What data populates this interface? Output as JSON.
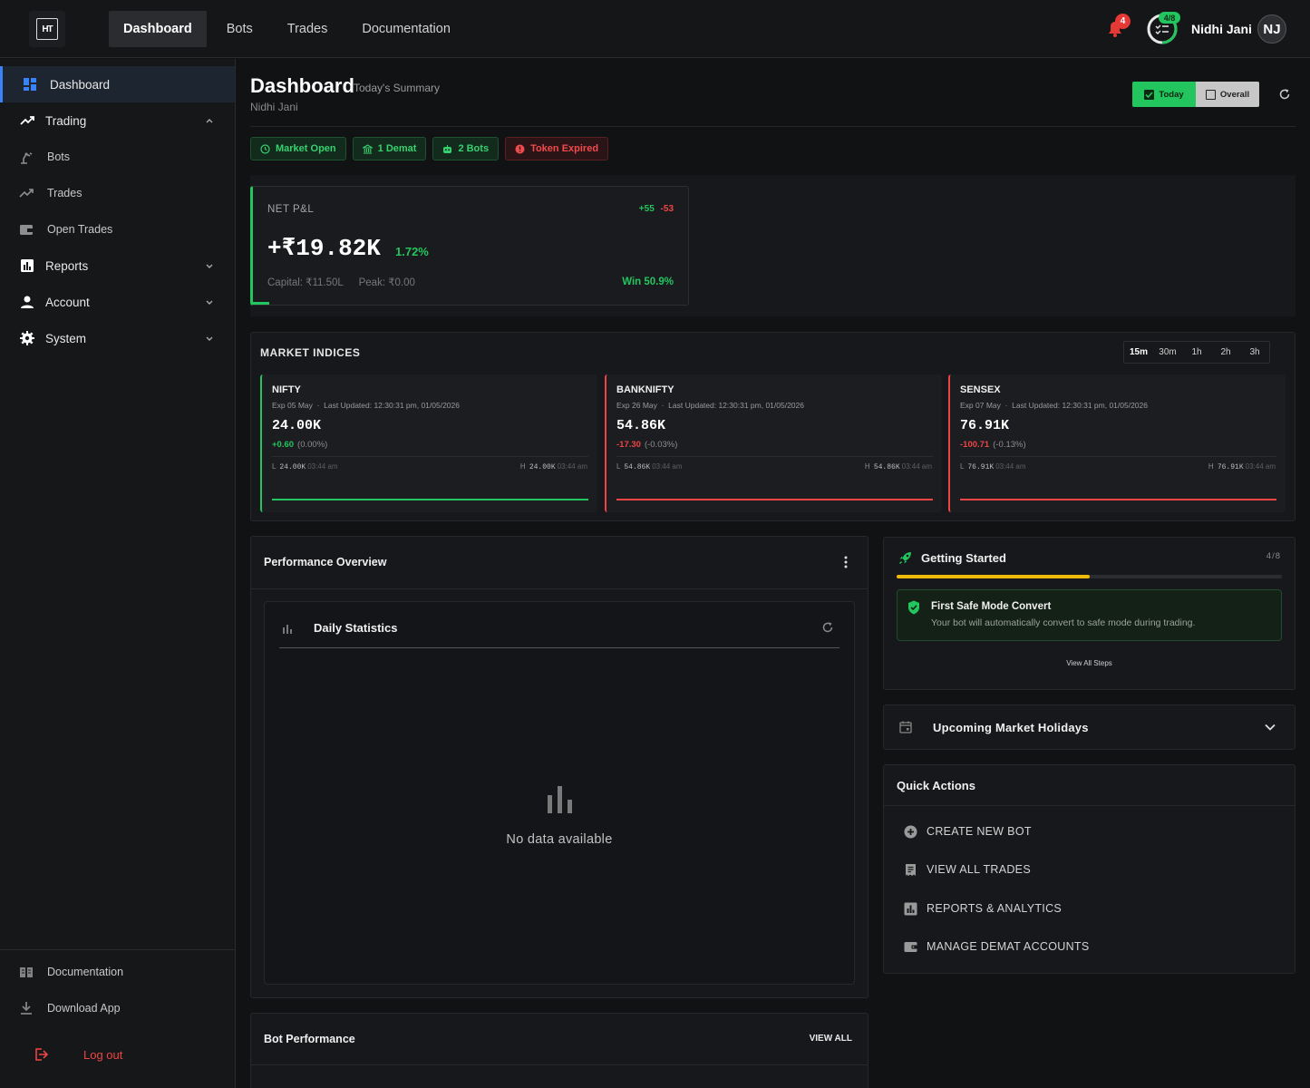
{
  "topbar": {
    "logo_text": "HT",
    "nav": [
      "Dashboard",
      "Bots",
      "Trades",
      "Documentation"
    ],
    "active_nav": "Dashboard",
    "notification_count": "4",
    "progress_badge": "4/8",
    "progress_fraction": 0.5,
    "user_name": "Nidhi Jani",
    "avatar_initials": "NJ"
  },
  "sidebar": {
    "dashboard": "Dashboard",
    "trading": "Trading",
    "trading_items": [
      "Bots",
      "Trades",
      "Open Trades"
    ],
    "reports": "Reports",
    "account": "Account",
    "system": "System",
    "documentation": "Documentation",
    "download": "Download App",
    "logout": "Log out"
  },
  "header": {
    "title": "Dashboard",
    "subtitle": "Today's Summary",
    "user": "Nidhi Jani",
    "toggle_today": "Today",
    "toggle_overall": "Overall"
  },
  "chips": {
    "market": "Market Open",
    "demat": "1 Demat",
    "bots": "2 Bots",
    "token": "Token Expired"
  },
  "pnl": {
    "label": "NET P&L",
    "wins": "+55",
    "losses": "-53",
    "value": "+₹19.82K",
    "percent": "1.72%",
    "capital": "Capital: ₹11.50L",
    "peak": "Peak: ₹0.00",
    "win_rate": "Win 50.9%"
  },
  "market": {
    "title": "MARKET INDICES",
    "timeframes": [
      "15m",
      "30m",
      "1h",
      "2h",
      "3h"
    ],
    "active_timeframe": "15m",
    "indices": [
      {
        "name": "NIFTY",
        "expiry": "Exp 05 May",
        "updated": "Last Updated: 12:30:31 pm, 01/05/2026",
        "value": "24.00K",
        "change": "+0.60",
        "change_pct": "(0.00%)",
        "low": "24.00K",
        "low_time": "03:44 am",
        "high": "24.00K",
        "high_time": "03:44 am",
        "direction": "up"
      },
      {
        "name": "BANKNIFTY",
        "expiry": "Exp 26 May",
        "updated": "Last Updated: 12:30:31 pm, 01/05/2026",
        "value": "54.86K",
        "change": "-17.30",
        "change_pct": "(-0.03%)",
        "low": "54.86K",
        "low_time": "03:44 am",
        "high": "54.86K",
        "high_time": "03:44 am",
        "direction": "down"
      },
      {
        "name": "SENSEX",
        "expiry": "Exp 07 May",
        "updated": "Last Updated: 12:30:31 pm, 01/05/2026",
        "value": "76.91K",
        "change": "-100.71",
        "change_pct": "(-0.13%)",
        "low": "76.91K",
        "low_time": "03:44 am",
        "high": "76.91K",
        "high_time": "03:44 am",
        "direction": "down"
      }
    ]
  },
  "performance": {
    "title": "Performance Overview",
    "daily_title": "Daily Statistics",
    "empty": "No data available"
  },
  "bot_performance": {
    "title": "Bot Performance",
    "view_all": "VIEW ALL"
  },
  "getting_started": {
    "title": "Getting Started",
    "count": "4/8",
    "progress": 0.5,
    "step_title": "First Safe Mode Convert",
    "step_desc": "Your bot will automatically convert to safe mode during trading.",
    "view_all": "View All Steps"
  },
  "holidays": {
    "title": "Upcoming Market Holidays"
  },
  "quick_actions": {
    "title": "Quick Actions",
    "items": [
      "CREATE NEW BOT",
      "VIEW ALL TRADES",
      "REPORTS & ANALYTICS",
      "MANAGE DEMAT ACCOUNTS"
    ]
  },
  "colors": {
    "accent_green": "#22c55e",
    "accent_red": "#ef4444",
    "accent_blue": "#3b82f6",
    "progress_yellow": "#f0b90b"
  }
}
